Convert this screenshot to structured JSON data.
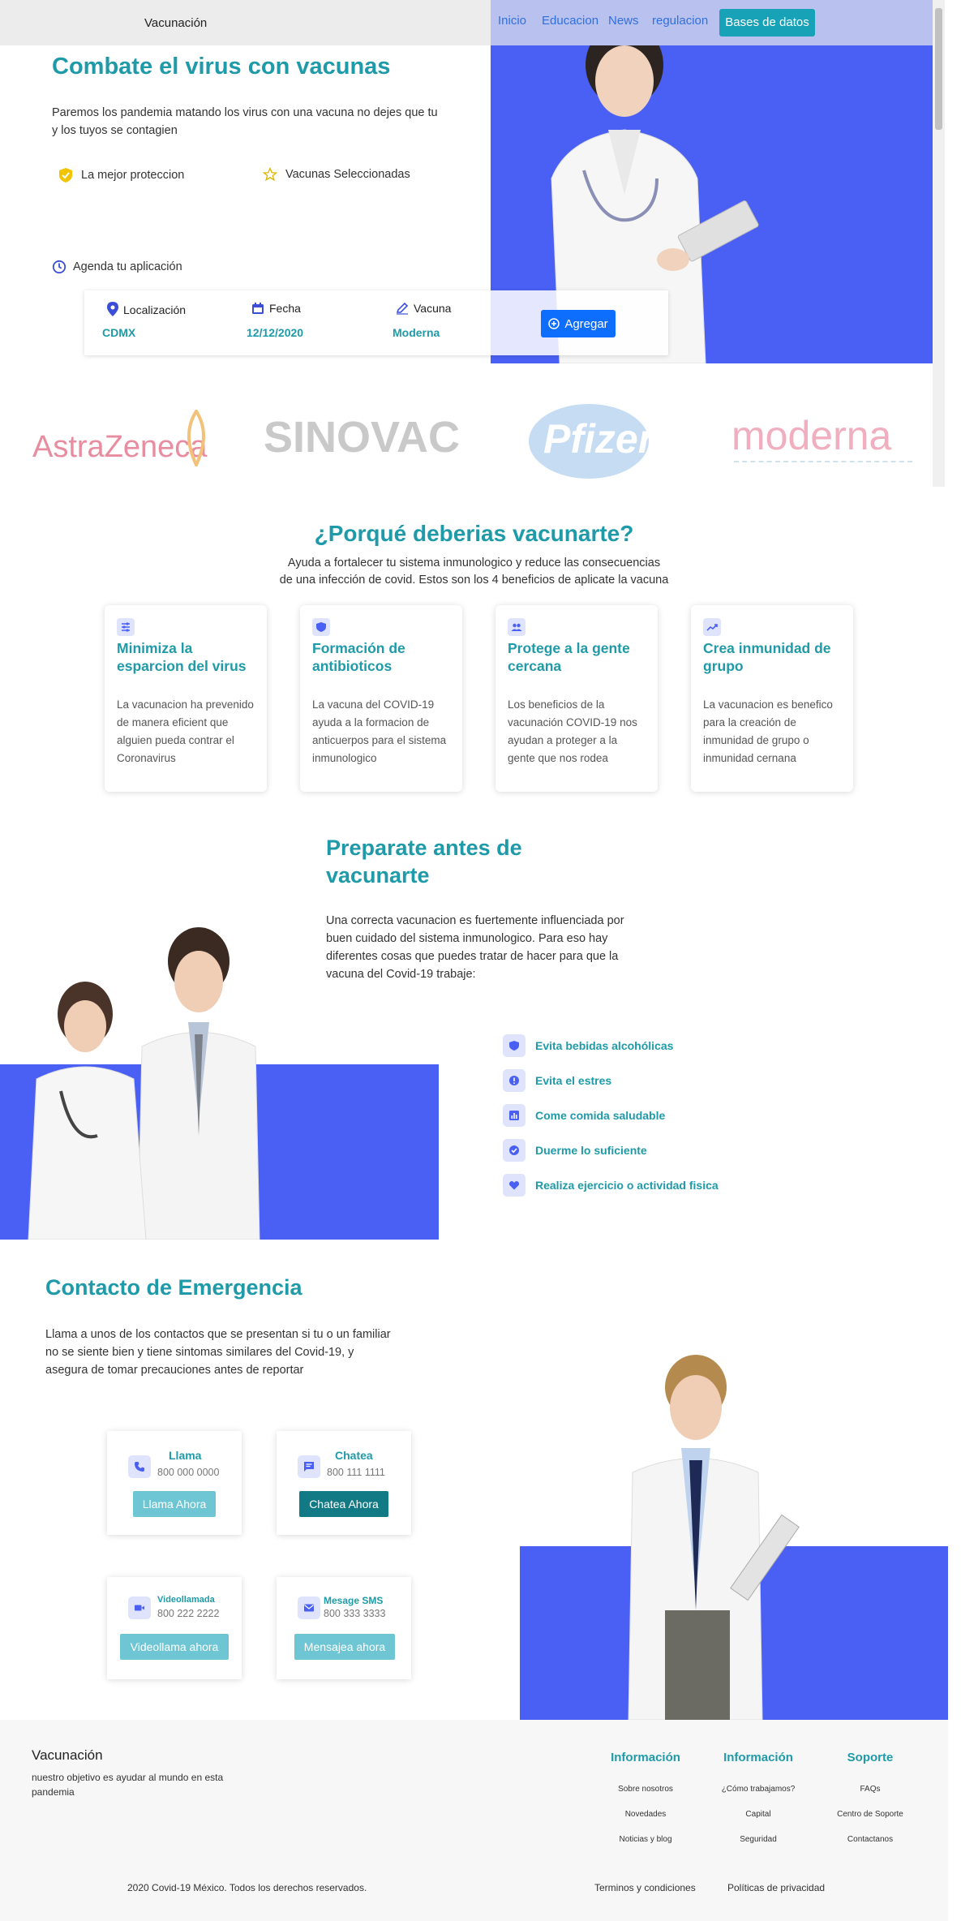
{
  "nav": {
    "brand": "Vacunación",
    "links": [
      "Inicio",
      "Educacion",
      "News",
      "regulacion"
    ],
    "db_button": "Bases de datos"
  },
  "hero": {
    "title": "Combate el virus con vacunas",
    "subtitle": "Paremos los pandemia matando los virus con una vacuna no dejes que tu y los tuyos se contagien",
    "features": [
      "La mejor proteccion",
      "Vacunas Seleccionadas"
    ],
    "agenda": "Agenda tu aplicación",
    "booking": {
      "location_label": "Localización",
      "location_value": "CDMX",
      "date_label": "Fecha",
      "date_value": "12/12/2020",
      "vaccine_label": "Vacuna",
      "vaccine_value": "Moderna",
      "add_button": "Agregar"
    },
    "logos": [
      "AstraZeneca",
      "SINOVAC",
      "Pfizer",
      "moderna"
    ]
  },
  "benefits": {
    "title": "¿Porqué deberias vacunarte?",
    "subtitle_1": "Ayuda a fortalecer tu sistema inmunologico y reduce las consecuencias",
    "subtitle_2": "de una infección de covid. Estos son los 4 beneficios de aplicate la vacuna",
    "cards": [
      {
        "title": "Minimiza la esparcion del virus",
        "text": "La vacunacion ha prevenido de manera eficient que alguien pueda contrar el Coronavirus"
      },
      {
        "title": "Formación de antibioticos",
        "text": "La vacuna del COVID-19 ayuda a la formacion de anticuerpos para el sistema inmunologico"
      },
      {
        "title": "Protege a la gente cercana",
        "text": "Los beneficios de la vacunación COVID-19 nos ayudan a proteger a la gente que nos rodea"
      },
      {
        "title": "Crea inmunidad de grupo",
        "text": "La vacunacion es benefico para la creación de inmunidad de grupo o inmunidad cernana"
      }
    ]
  },
  "prepare": {
    "title": "Preparate antes de vacunarte",
    "text": "Una correcta vacunacion es fuertemente influenciada por buen cuidado del sistema inmunologico. Para eso hay diferentes cosas que puedes tratar de hacer para que la vacuna del Covid-19 trabaje:",
    "tips": [
      "Evita bebidas alcohólicas",
      "Evita el estres",
      "Come comida saludable",
      "Duerme lo suficiente",
      "Realiza ejercicio o actividad fisica"
    ]
  },
  "contact": {
    "title": "Contacto de Emergencia",
    "text": "Llama a unos de los contactos que se presentan si tu o un familiar no se siente bien y tiene sintomas similares del Covid-19, y asegura de tomar precauciones antes de reportar",
    "cards": [
      {
        "title": "Llama",
        "number": "800 000 0000",
        "button": "Llama Ahora"
      },
      {
        "title": "Chatea",
        "number": "800 111 1111",
        "button": "Chatea Ahora"
      },
      {
        "title": "Videollamada",
        "number": "800 222 2222",
        "button": "Videollama ahora"
      },
      {
        "title": "Mesage SMS",
        "number": "800 333 3333",
        "button": "Mensajea ahora"
      }
    ]
  },
  "footer": {
    "brand": "Vacunación",
    "tagline": "nuestro objetivo es ayudar al mundo en esta pandemia",
    "columns": [
      {
        "title": "Información",
        "links": [
          "Sobre nosotros",
          "Novedades",
          "Noticias y blog"
        ]
      },
      {
        "title": "Información",
        "links": [
          "¿Cómo trabajamos?",
          "Capital",
          "Seguridad"
        ]
      },
      {
        "title": "Soporte",
        "links": [
          "FAQs",
          "Centro de Soporte",
          "Contactanos"
        ]
      }
    ],
    "copyright": "2020 Covid-19 México. Todos los derechos reservados.",
    "terms": "Terminos y condiciones",
    "privacy": "Políticas de privacidad"
  },
  "colors": {
    "teal": "#1f9aa8",
    "blue": "#4a60f5",
    "primary": "#0d6efd",
    "info": "#17a2b8"
  }
}
